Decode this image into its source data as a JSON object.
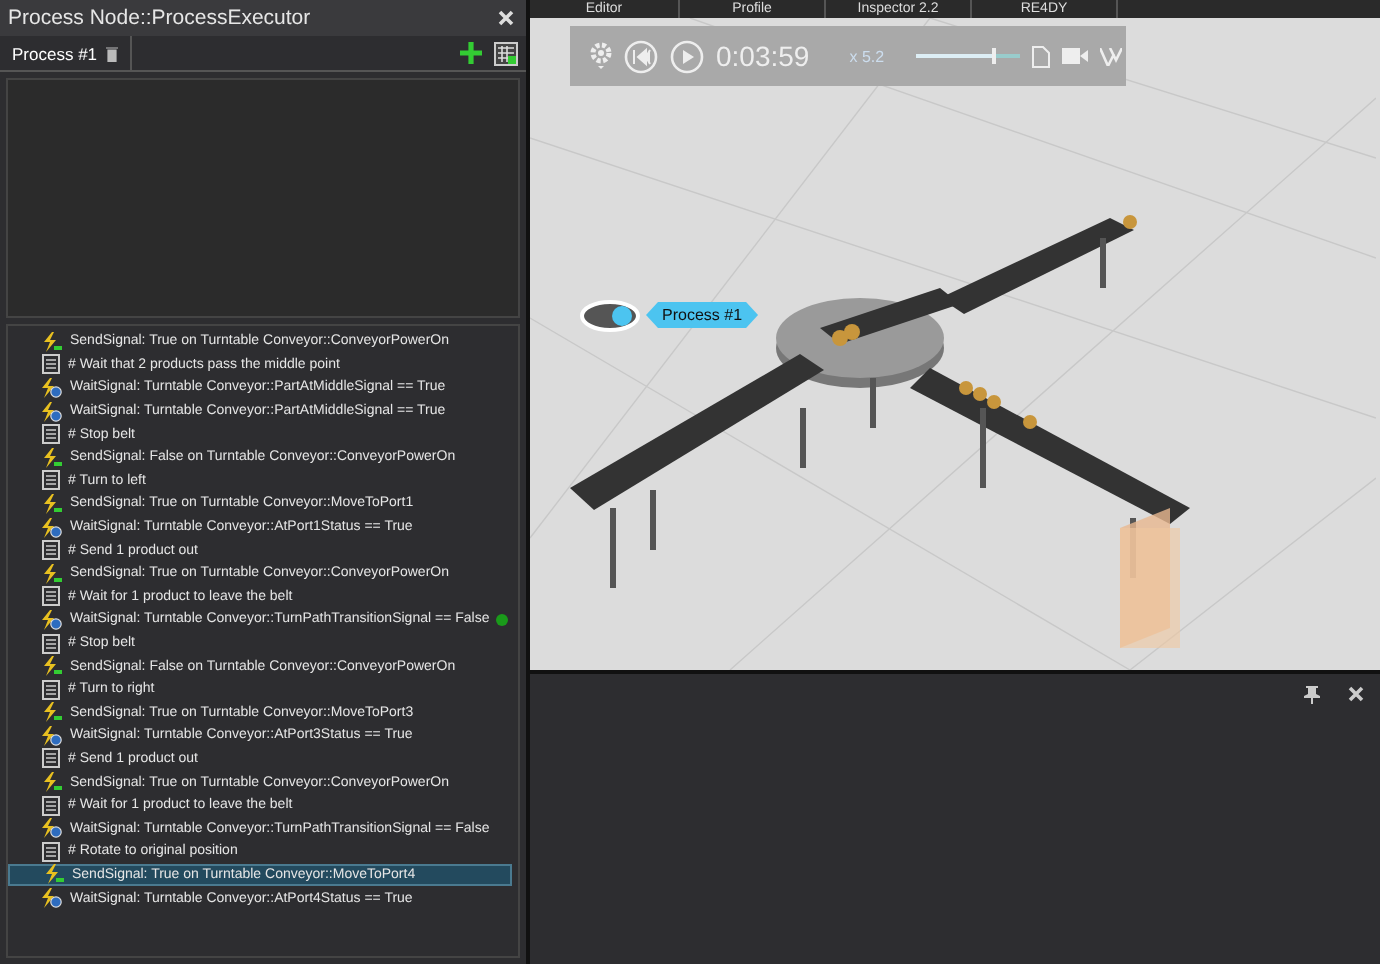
{
  "left_panel": {
    "title": "Process Node::ProcessExecutor",
    "tabs": [
      {
        "label": "Process #1",
        "selected": true
      }
    ],
    "steps": [
      {
        "kind": "send",
        "text": "SendSignal: True on Turntable Conveyor::ConveyorPowerOn",
        "selected": false,
        "running": false
      },
      {
        "kind": "comment",
        "text": "# Wait that 2 products pass the middle point",
        "selected": false,
        "running": false
      },
      {
        "kind": "wait",
        "text": "WaitSignal: Turntable Conveyor::PartAtMiddleSignal == True",
        "selected": false,
        "running": false
      },
      {
        "kind": "wait",
        "text": "WaitSignal: Turntable Conveyor::PartAtMiddleSignal == True",
        "selected": false,
        "running": false
      },
      {
        "kind": "comment",
        "text": "# Stop belt",
        "selected": false,
        "running": false
      },
      {
        "kind": "send",
        "text": "SendSignal: False on Turntable Conveyor::ConveyorPowerOn",
        "selected": false,
        "running": false
      },
      {
        "kind": "comment",
        "text": "# Turn to left",
        "selected": false,
        "running": false
      },
      {
        "kind": "send",
        "text": "SendSignal: True on Turntable Conveyor::MoveToPort1",
        "selected": false,
        "running": false
      },
      {
        "kind": "wait",
        "text": "WaitSignal: Turntable Conveyor::AtPort1Status == True",
        "selected": false,
        "running": false
      },
      {
        "kind": "comment",
        "text": "# Send 1 product out",
        "selected": false,
        "running": false
      },
      {
        "kind": "send",
        "text": "SendSignal: True on Turntable Conveyor::ConveyorPowerOn",
        "selected": false,
        "running": false
      },
      {
        "kind": "comment",
        "text": "# Wait for 1 product to leave the belt",
        "selected": false,
        "running": false
      },
      {
        "kind": "wait",
        "text": "WaitSignal: Turntable Conveyor::TurnPathTransitionSignal == False",
        "selected": false,
        "running": true
      },
      {
        "kind": "comment",
        "text": "# Stop belt",
        "selected": false,
        "running": false
      },
      {
        "kind": "send",
        "text": "SendSignal: False on Turntable Conveyor::ConveyorPowerOn",
        "selected": false,
        "running": false
      },
      {
        "kind": "comment",
        "text": "# Turn to right",
        "selected": false,
        "running": false
      },
      {
        "kind": "send",
        "text": "SendSignal: True on Turntable Conveyor::MoveToPort3",
        "selected": false,
        "running": false
      },
      {
        "kind": "wait",
        "text": "WaitSignal: Turntable Conveyor::AtPort3Status == True",
        "selected": false,
        "running": false
      },
      {
        "kind": "comment",
        "text": "# Send 1 product out",
        "selected": false,
        "running": false
      },
      {
        "kind": "send",
        "text": "SendSignal: True on Turntable Conveyor::ConveyorPowerOn",
        "selected": false,
        "running": false
      },
      {
        "kind": "comment",
        "text": "# Wait for 1 product to leave the belt",
        "selected": false,
        "running": false
      },
      {
        "kind": "wait",
        "text": "WaitSignal: Turntable Conveyor::TurnPathTransitionSignal == False",
        "selected": false,
        "running": false
      },
      {
        "kind": "comment",
        "text": "# Rotate to original position",
        "selected": false,
        "running": false
      },
      {
        "kind": "send",
        "text": "SendSignal: True on Turntable Conveyor::MoveToPort4",
        "selected": true,
        "running": false
      },
      {
        "kind": "wait",
        "text": "WaitSignal: Turntable Conveyor::AtPort4Status == True",
        "selected": false,
        "running": false
      }
    ]
  },
  "top_tabs": [
    "Editor",
    "Profile",
    "Inspector 2.2",
    "RE4DY"
  ],
  "playback": {
    "time": "0:03:59",
    "speed": "x 5.2",
    "level": 0.72
  },
  "viewport": {
    "process_label": "Process #1"
  }
}
